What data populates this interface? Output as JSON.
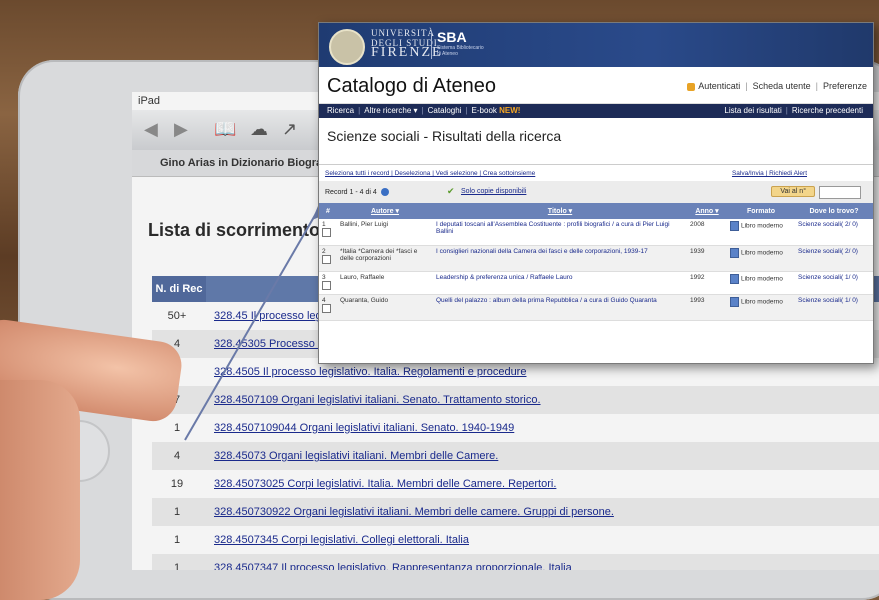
{
  "ipad": {
    "status": "iPad",
    "breadcrumb": "Gino Arias in Dizionario Biografi",
    "list_title": "Lista di scorrimento: L",
    "col_header": "N. di Rec",
    "rows": [
      {
        "count": "50+",
        "subject": "328.45 Il processo legi"
      },
      {
        "count": "4",
        "subject": "328.45305 Processo le"
      },
      {
        "count": "1",
        "subject": "328.4505 Il processo legislativo. Italia. Regolamenti e procedure"
      },
      {
        "count": "7",
        "subject": "328.4507109 Organi legislativi italiani. Senato. Trattamento storico."
      },
      {
        "count": "1",
        "subject": "328.4507109044 Organi legislativi italiani. Senato. 1940-1949"
      },
      {
        "count": "4",
        "subject": "328.45073 Organi legislativi italiani. Membri delle Camere."
      },
      {
        "count": "19",
        "subject": "328.45073025 Corpi legislativi. Italia. Membri delle Camere. Repertori."
      },
      {
        "count": "1",
        "subject": "328.450730922 Organi legislativi italiani. Membri delle camere. Gruppi di persone."
      },
      {
        "count": "1",
        "subject": "328.4507345 Corpi legislativi. Collegi elettorali. Italia"
      },
      {
        "count": "1",
        "subject": "328.4507347 Il processo legislativo. Rappresentanza proporzionale. Italia"
      }
    ]
  },
  "catalog": {
    "uni_line1": "UNIVERSITÀ",
    "uni_line2": "DEGLI STUDI",
    "uni_line3": "FIRENZE",
    "sba": "SBA",
    "sba_sub1": "Sistema Bibliotecario",
    "sba_sub2": "di Ateneo",
    "title": "Catalogo di Ateneo",
    "links": {
      "login": "Autenticati",
      "card": "Scheda utente",
      "prefs": "Preferenze"
    },
    "nav": {
      "ricerca": "Ricerca",
      "altre": "Altre ricerche ▾",
      "cataloghi": "Cataloghi",
      "ebook": "E-book",
      "ebook_new": "NEW!",
      "lista": "Lista dei risultati",
      "precedenti": "Ricerche precedenti"
    },
    "results_title": "Scienze sociali - Risultati della ricerca",
    "select_links": "Seleziona tutti i record | Deseleziona | Vedi selezione | Crea sottoinsieme",
    "save_links": "Salva/Invia | Richiedi Alert",
    "record_count": "Record 1 - 4 di 4",
    "solo_link": "Solo copie disponibili",
    "goto_label": "Vai al n°",
    "headers": {
      "num": "#",
      "autore": "Autore ▾",
      "titolo": "Titolo ▾",
      "anno": "Anno ▾",
      "formato": "Formato",
      "dove": "Dove lo trovo?"
    },
    "results": [
      {
        "n": "1",
        "autore": "Ballini, Pier Luigi",
        "titolo": "I deputati toscani all'Assemblea Costituente : profili biografici / a cura di Pier Luigi Ballini",
        "anno": "2008",
        "formato": "Libro moderno",
        "dove": "Scienze sociali( 2/ 0)"
      },
      {
        "n": "2",
        "autore": "*Italia *Camera dei *fasci e delle corporazioni",
        "titolo": "I consiglieri nazionali della Camera dei fasci e delle corporazioni, 1939-17",
        "anno": "1939",
        "formato": "Libro moderno",
        "dove": "Scienze sociali( 2/ 0)"
      },
      {
        "n": "3",
        "autore": "Lauro, Raffaele",
        "titolo": "Leadership & preferenza unica / Raffaele Lauro",
        "anno": "1992",
        "formato": "Libro moderno",
        "dove": "Scienze sociali( 1/ 0)"
      },
      {
        "n": "4",
        "autore": "Quaranta, Guido",
        "titolo": "Quelli del palazzo : album della prima Repubblica / a cura di Guido Quaranta",
        "anno": "1993",
        "formato": "Libro moderno",
        "dove": "Scienze sociali( 1/ 0)"
      }
    ]
  }
}
